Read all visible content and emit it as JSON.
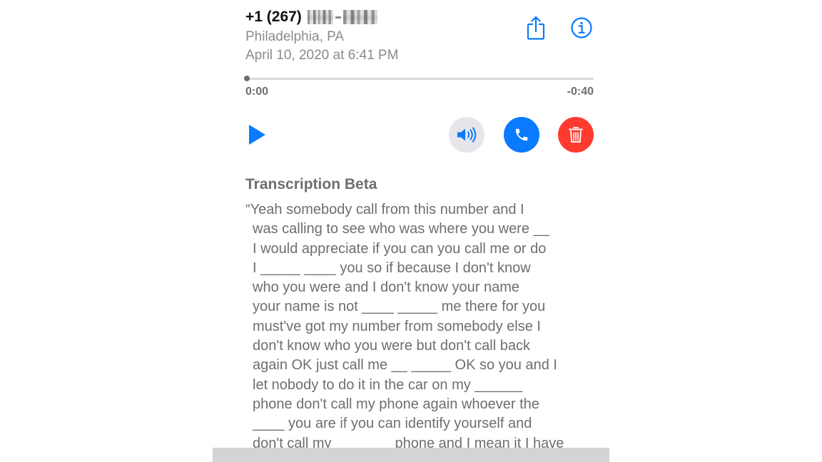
{
  "header": {
    "number_prefix": "+1 (267)",
    "location": "Philadelphia, PA",
    "datetime": "April 10, 2020 at 6:41 PM"
  },
  "icons": {
    "share": "share-icon",
    "info": "info-icon",
    "play": "play-icon",
    "speaker": "speaker-icon",
    "call": "phone-icon",
    "delete": "trash-icon"
  },
  "playback": {
    "elapsed": "0:00",
    "remaining": "-0:40",
    "progress": 0.0
  },
  "transcription": {
    "title": "Transcription Beta",
    "lines": [
      "“Yeah somebody call from this number and I",
      "was calling to see who was where you were __",
      "I would appreciate if you can you call me or do",
      "I _____ ____ you so if because I don't know",
      "who you were and I don't know your name",
      "your name is not ____ _____ me there for you",
      "must've got my number from somebody else I",
      "don't know who you were but don't call back",
      "again OK just call me __ _____ OK so you and I",
      "let nobody to do it in the car on my ______",
      "phone don't call my phone again whoever the",
      "____ you are if you can identify yourself and",
      "don't call my _______ phone and I mean it I have"
    ]
  },
  "colors": {
    "accent_blue": "#0a7aff",
    "delete_red": "#ff3b30",
    "speaker_gray": "#e5e5ea",
    "secondary_text": "#8a8a8e"
  }
}
